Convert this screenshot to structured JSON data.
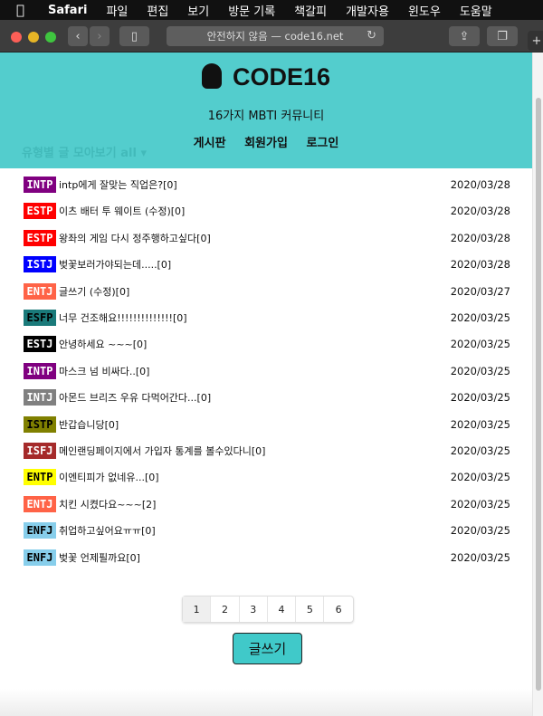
{
  "menubar": {
    "apple": "",
    "app": "Safari",
    "items": [
      "파일",
      "편집",
      "보기",
      "방문 기록",
      "책갈피",
      "개발자용",
      "윈도우",
      "도움말"
    ]
  },
  "browser": {
    "url": "안전하지 않음 — code16.net",
    "colors": {
      "close": "#fc5f57",
      "minimize": "#e6b526",
      "zoom": "#3fc53f"
    }
  },
  "header": {
    "logo": "CODE16",
    "subtitle": "16가지 MBTI 커뮤니티",
    "nav": [
      "게시판",
      "회원가입",
      "로그인"
    ],
    "filter": "유형별 글 모아보기 all ▾",
    "bg": "#53cdcd"
  },
  "posts": [
    {
      "type": "INTP",
      "bg": "#800080",
      "fg": "#fff",
      "title": "intp에게 잘맞는 직업은?[0]",
      "date": "2020/03/28"
    },
    {
      "type": "ESTP",
      "bg": "#ff0000",
      "fg": "#fff",
      "title": "이츠 배터 투 웨이트 (수정)[0]",
      "date": "2020/03/28"
    },
    {
      "type": "ESTP",
      "bg": "#ff0000",
      "fg": "#fff",
      "title": "왕좌의 게임 다시 정주행하고싶다[0]",
      "date": "2020/03/28"
    },
    {
      "type": "ISTJ",
      "bg": "#0000ff",
      "fg": "#fff",
      "title": "벚꽃보러가야되는데.....[0]",
      "date": "2020/03/28"
    },
    {
      "type": "ENTJ",
      "bg": "#ff6347",
      "fg": "#fff",
      "title": "글쓰기 (수정)[0]",
      "date": "2020/03/27"
    },
    {
      "type": "ESFP",
      "bg": "#1a7a7a",
      "fg": "#000",
      "title": "너무 건조해요!!!!!!!!!!!!!![0]",
      "date": "2020/03/25"
    },
    {
      "type": "ESTJ",
      "bg": "#000000",
      "fg": "#fff",
      "title": "안녕하세요 ~~~[0]",
      "date": "2020/03/25"
    },
    {
      "type": "INTP",
      "bg": "#800080",
      "fg": "#fff",
      "title": "마스크 넘 비싸다..[0]",
      "date": "2020/03/25"
    },
    {
      "type": "INTJ",
      "bg": "#808080",
      "fg": "#fff",
      "title": "아몬드 브리즈 우유 다먹어간다...[0]",
      "date": "2020/03/25"
    },
    {
      "type": "ISTP",
      "bg": "#808000",
      "fg": "#000",
      "title": "반갑습니당[0]",
      "date": "2020/03/25"
    },
    {
      "type": "ISFJ",
      "bg": "#a52a2a",
      "fg": "#fff",
      "title": "메인랜딩페이지에서 가입자 통계를 볼수있다니[0]",
      "date": "2020/03/25"
    },
    {
      "type": "ENTP",
      "bg": "#ffff00",
      "fg": "#000",
      "title": "이엔티피가 없네유...[0]",
      "date": "2020/03/25"
    },
    {
      "type": "ENTJ",
      "bg": "#ff6347",
      "fg": "#fff",
      "title": "치킨 시켰다요~~~[2]",
      "date": "2020/03/25"
    },
    {
      "type": "ENFJ",
      "bg": "#87ceeb",
      "fg": "#000",
      "title": "취업하고싶어요ㅠㅠ[0]",
      "date": "2020/03/25"
    },
    {
      "type": "ENFJ",
      "bg": "#87ceeb",
      "fg": "#000",
      "title": "벚꽃 언제필까요[0]",
      "date": "2020/03/25"
    }
  ],
  "pagination": {
    "pages": [
      "1",
      "2",
      "3",
      "4",
      "5",
      "6"
    ],
    "current": "1"
  },
  "write_button": "글쓰기"
}
